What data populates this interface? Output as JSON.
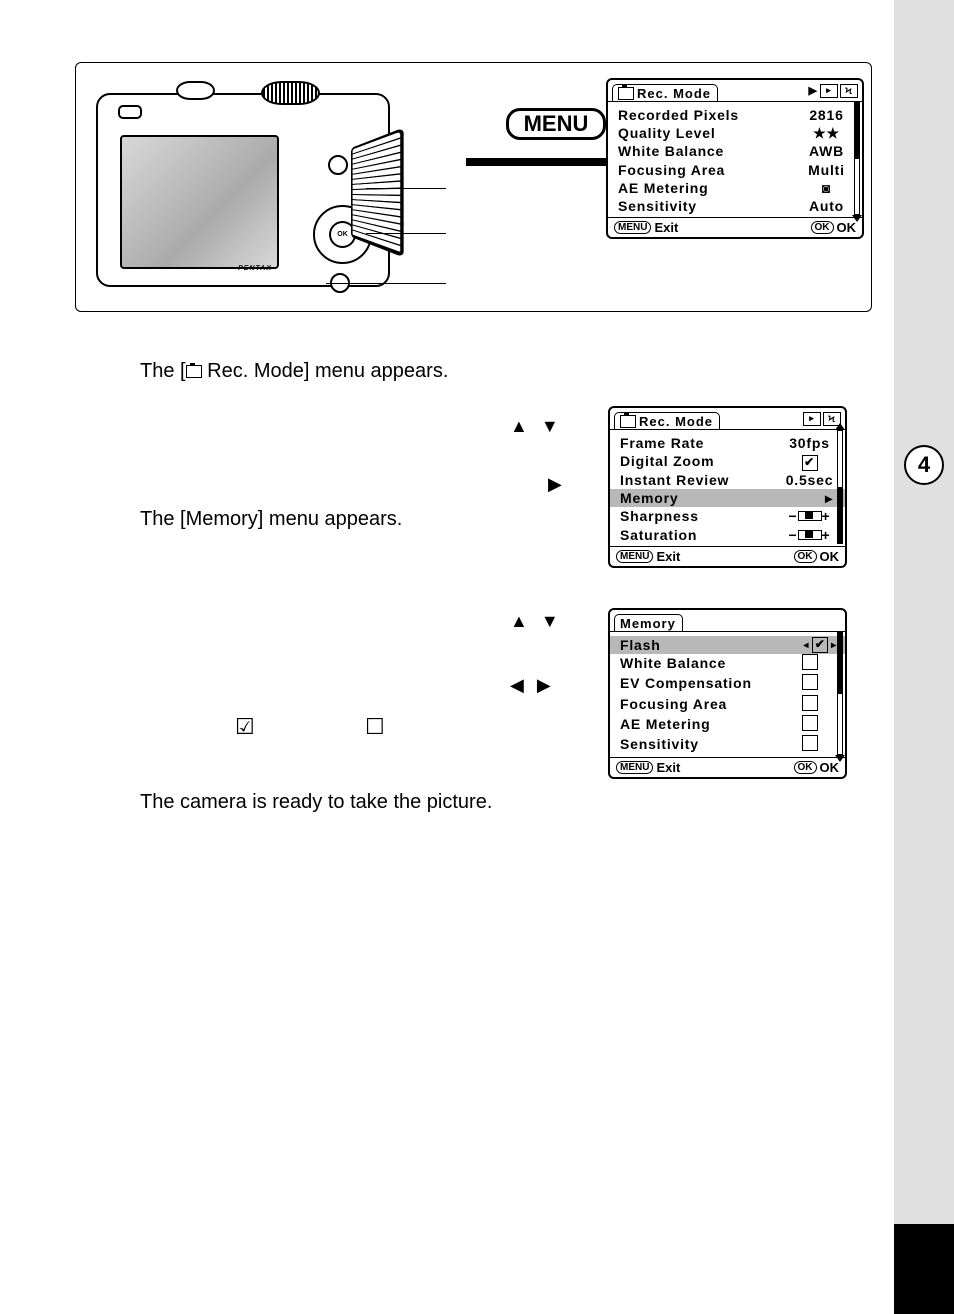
{
  "top": {
    "menu_button_label": "MENU",
    "camera_brand": "PENTAX",
    "ok_center": "OK"
  },
  "lcd1": {
    "title": "Rec. Mode",
    "rows": [
      {
        "label": "Recorded Pixels",
        "val": "2816"
      },
      {
        "label": "Quality Level",
        "val": "★★"
      },
      {
        "label": "White Balance",
        "val": "AWB"
      },
      {
        "label": "Focusing Area",
        "val": "Multi"
      },
      {
        "label": "AE Metering",
        "val": "◙"
      },
      {
        "label": "Sensitivity",
        "val": "Auto"
      }
    ],
    "footer_menu": "MENU",
    "footer_exit": "Exit",
    "footer_ok_btn": "OK",
    "footer_ok": "OK"
  },
  "lcd2": {
    "title": "Rec. Mode",
    "rows": [
      {
        "label": "Frame Rate",
        "val": "30fps"
      },
      {
        "label": "Digital Zoom",
        "val": "check"
      },
      {
        "label": "Instant Review",
        "val": "0.5sec"
      },
      {
        "label": "Memory",
        "val": "▸",
        "highlight": true
      },
      {
        "label": "Sharpness",
        "val": "slider"
      },
      {
        "label": "Saturation",
        "val": "slider"
      }
    ],
    "footer_menu": "MENU",
    "footer_exit": "Exit",
    "footer_ok_btn": "OK",
    "footer_ok": "OK"
  },
  "lcd3": {
    "title": "Memory",
    "rows": [
      {
        "label": "Flash",
        "val": "check-nav",
        "highlight": true
      },
      {
        "label": "White Balance",
        "val": "box"
      },
      {
        "label": "EV Compensation",
        "val": "box"
      },
      {
        "label": "Focusing Area",
        "val": "box"
      },
      {
        "label": "AE Metering",
        "val": "box"
      },
      {
        "label": "Sensitivity",
        "val": "box"
      }
    ],
    "footer_menu": "MENU",
    "footer_exit": "Exit",
    "footer_ok_btn": "OK",
    "footer_ok": "OK"
  },
  "text": {
    "line1a": "The [",
    "line1b": " Rec. Mode] menu appears.",
    "line2": "The [Memory] menu appears.",
    "line3": "The camera is ready to take the picture."
  },
  "arrows": {
    "updown": "▲ ▼",
    "right": "▶",
    "leftright": "◀ ▶"
  },
  "icons_inline": {
    "checked": "☑",
    "unchecked": "☐"
  },
  "section_number": "4"
}
